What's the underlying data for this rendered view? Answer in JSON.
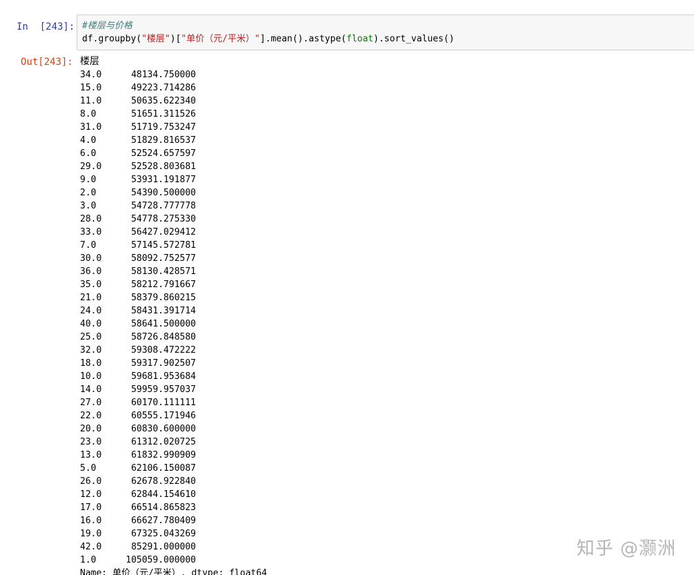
{
  "notebook": {
    "input_prompt": "In  [243]:",
    "output_prompt": "Out[243]:",
    "code": {
      "comment": "#楼层与价格",
      "line_parts": [
        {
          "t": "plain",
          "s": "df.groupby("
        },
        {
          "t": "str",
          "s": "\"楼层\""
        },
        {
          "t": "plain",
          "s": ")["
        },
        {
          "t": "str",
          "s": "\"单价（元/平米）\""
        },
        {
          "t": "plain",
          "s": "].mean().astype("
        },
        {
          "t": "builtin",
          "s": "float"
        },
        {
          "t": "plain",
          "s": ").sort_values()"
        }
      ]
    },
    "output": {
      "index_name": "楼层",
      "rows": [
        {
          "k": "34.0",
          "v": "48134.750000"
        },
        {
          "k": "15.0",
          "v": "49223.714286"
        },
        {
          "k": "11.0",
          "v": "50635.622340"
        },
        {
          "k": "8.0",
          "v": "51651.311526"
        },
        {
          "k": "31.0",
          "v": "51719.753247"
        },
        {
          "k": "4.0",
          "v": "51829.816537"
        },
        {
          "k": "6.0",
          "v": "52524.657597"
        },
        {
          "k": "29.0",
          "v": "52528.803681"
        },
        {
          "k": "9.0",
          "v": "53931.191877"
        },
        {
          "k": "2.0",
          "v": "54390.500000"
        },
        {
          "k": "3.0",
          "v": "54728.777778"
        },
        {
          "k": "28.0",
          "v": "54778.275330"
        },
        {
          "k": "33.0",
          "v": "56427.029412"
        },
        {
          "k": "7.0",
          "v": "57145.572781"
        },
        {
          "k": "30.0",
          "v": "58092.752577"
        },
        {
          "k": "36.0",
          "v": "58130.428571"
        },
        {
          "k": "35.0",
          "v": "58212.791667"
        },
        {
          "k": "21.0",
          "v": "58379.860215"
        },
        {
          "k": "24.0",
          "v": "58431.391714"
        },
        {
          "k": "40.0",
          "v": "58641.500000"
        },
        {
          "k": "25.0",
          "v": "58726.848580"
        },
        {
          "k": "32.0",
          "v": "59308.472222"
        },
        {
          "k": "18.0",
          "v": "59317.902507"
        },
        {
          "k": "10.0",
          "v": "59681.953684"
        },
        {
          "k": "14.0",
          "v": "59959.957037"
        },
        {
          "k": "27.0",
          "v": "60170.111111"
        },
        {
          "k": "22.0",
          "v": "60555.171946"
        },
        {
          "k": "20.0",
          "v": "60830.600000"
        },
        {
          "k": "23.0",
          "v": "61312.020725"
        },
        {
          "k": "13.0",
          "v": "61832.990909"
        },
        {
          "k": "5.0",
          "v": "62106.150087"
        },
        {
          "k": "26.0",
          "v": "62678.922840"
        },
        {
          "k": "12.0",
          "v": "62844.154610"
        },
        {
          "k": "17.0",
          "v": "66514.865823"
        },
        {
          "k": "16.0",
          "v": "66627.780409"
        },
        {
          "k": "19.0",
          "v": "67325.043269"
        },
        {
          "k": "42.0",
          "v": "85291.000000"
        },
        {
          "k": "1.0",
          "v": "105059.000000"
        }
      ],
      "footer": "Name: 单价（元/平米）, dtype: float64"
    }
  },
  "watermark": "知乎 @灏洲"
}
